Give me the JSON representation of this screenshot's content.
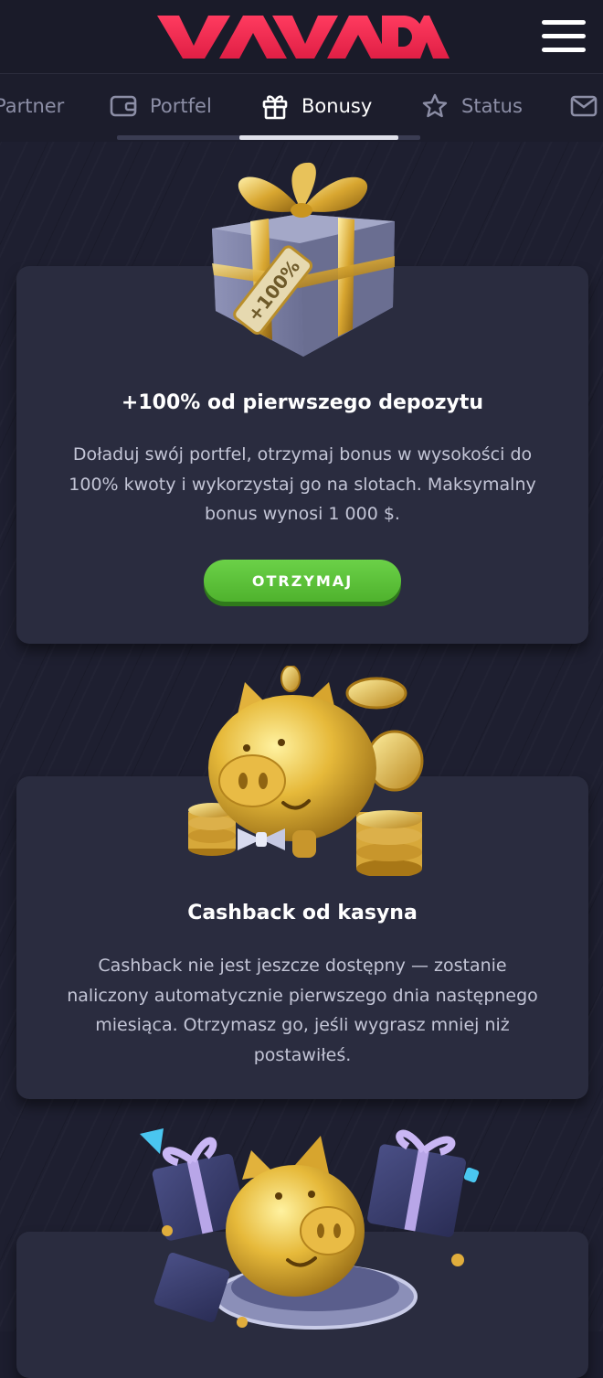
{
  "header": {
    "logo_text": "VAVADA",
    "menu_icon": "hamburger-menu-icon",
    "logo_color": "#ef2a50"
  },
  "tabs": [
    {
      "label": "Partner",
      "icon": "none",
      "active": false
    },
    {
      "label": "Portfel",
      "icon": "wallet-icon",
      "active": false
    },
    {
      "label": "Bonusy",
      "icon": "gift-icon",
      "active": true
    },
    {
      "label": "Status",
      "icon": "star-icon",
      "active": false
    },
    {
      "label": "",
      "icon": "mail-icon",
      "active": false
    }
  ],
  "cards": [
    {
      "title": "+100% od pierwszego depozytu",
      "lines": [
        "Doładuj swój portfel, otrzymaj bonus w wysokości do",
        "100% kwoty i wykorzystaj go na slotach. Maksymalny",
        "bonus wynosi 1 000 $."
      ],
      "button_label": "OTRZYMAJ",
      "image": "gift-box-100-illustration",
      "tag_text": "+100%"
    },
    {
      "title": "Cashback od kasyna",
      "lines": [
        "Cashback nie jest jeszcze dostępny — zostanie",
        "naliczony automatycznie pierwszego dnia następnego",
        "miesiąca. Otrzymasz go, jeśli wygrasz mniej niż",
        "postawiłeś."
      ],
      "image": "golden-piggy-bank-illustration"
    },
    {
      "title": "",
      "image": "piggy-bank-with-gifts-illustration"
    }
  ],
  "colors": {
    "background": "#1e1f30",
    "card": "#2a2c3f",
    "button_green": "#5cc33a",
    "gold": "#e6b93a"
  }
}
